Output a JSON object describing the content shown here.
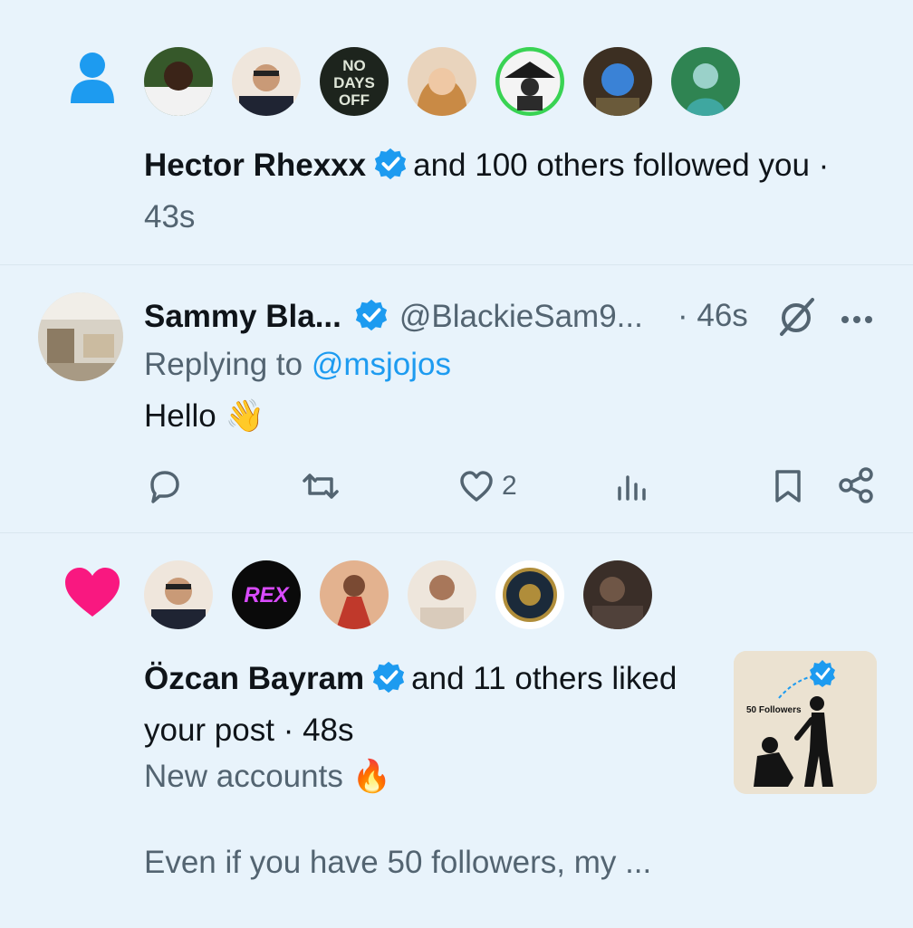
{
  "follow_notification": {
    "actor": "Hector Rhexxx",
    "text": "and 100 others followed you ·",
    "time": "43s",
    "icon": "person-icon",
    "avatars": [
      {
        "name": "avatar-1",
        "color": "#3b5d2c"
      },
      {
        "name": "avatar-2",
        "color": "#d9b79a"
      },
      {
        "name": "avatar-3",
        "label": "NO DAYS OFF",
        "color": "#1e2a1e"
      },
      {
        "name": "avatar-4",
        "color": "#d9a47a"
      },
      {
        "name": "avatar-5",
        "color": "#2b2b2b"
      },
      {
        "name": "avatar-6",
        "color": "#3a6fb0"
      },
      {
        "name": "avatar-7",
        "color": "#2f7d4c"
      }
    ]
  },
  "reply": {
    "author": "Sammy Bla...",
    "handle": "@BlackieSam9...",
    "time": "· 46s",
    "replying_prefix": "Replying to",
    "replying_to": "@msjojos",
    "text": "Hello",
    "emoji": "👋",
    "likes": "2"
  },
  "like_notification": {
    "actor": "Özcan Bayram",
    "text_part1": "and 11 others liked",
    "text_part2": "your post · 48s",
    "post_line1": "New accounts",
    "post_emoji": "🔥",
    "post_line2": "Even if you have 50 followers, my ...",
    "thumbnail_label": "50 Followers",
    "icon": "heart-icon",
    "avatars": [
      {
        "name": "avatar-1",
        "color": "#d9b79a"
      },
      {
        "name": "avatar-2",
        "label": "REX",
        "color": "#0c0c0c"
      },
      {
        "name": "avatar-3",
        "color": "#c0392b"
      },
      {
        "name": "avatar-4",
        "color": "#e8dccf"
      },
      {
        "name": "avatar-5",
        "color": "#ffffff"
      },
      {
        "name": "avatar-6",
        "color": "#5b4a3f"
      }
    ]
  },
  "colors": {
    "accent": "#1d9bf0",
    "heart": "#f91880",
    "background": "#e8f3fb",
    "muted": "#536471"
  }
}
